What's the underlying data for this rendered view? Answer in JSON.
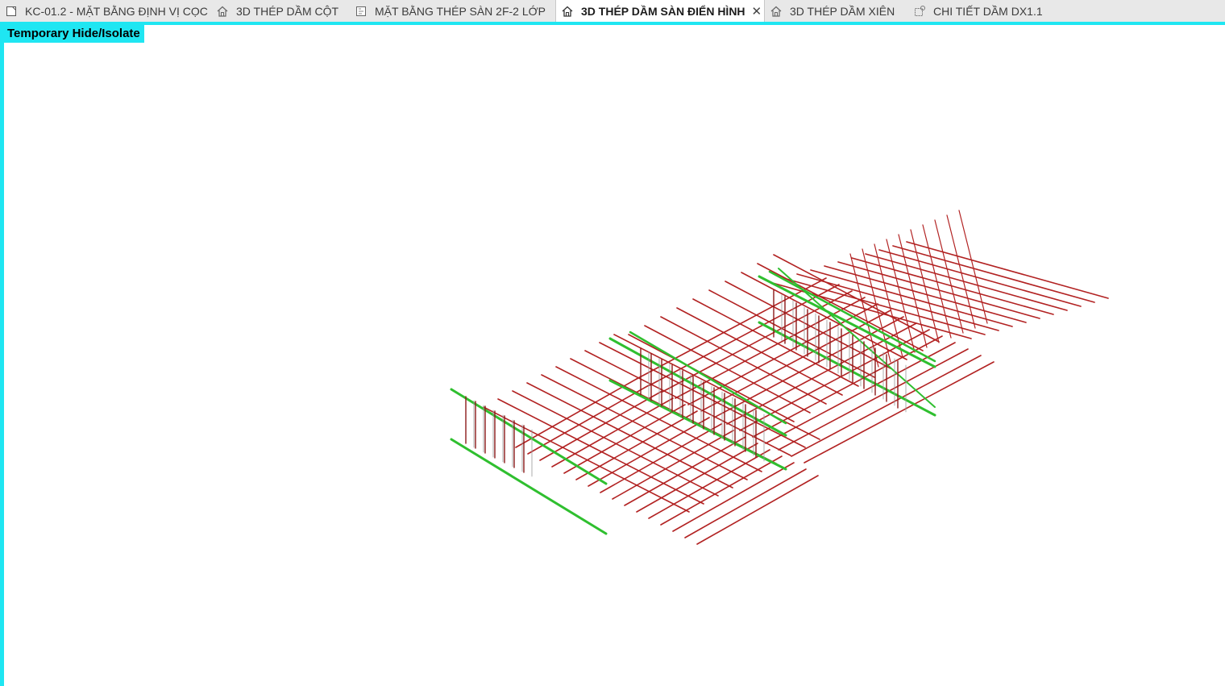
{
  "tabs": [
    {
      "label": "KC-01.2 - MẶT BẰNG ĐỊNH VỊ CỌC",
      "icon": "sheet-icon",
      "active": false
    },
    {
      "label": "3D THÉP DẦM CỘT",
      "icon": "3d-house-icon",
      "active": false
    },
    {
      "label": "MẶT BẰNG THÉP SÀN 2F-2 LỚP",
      "icon": "floor-plan-icon",
      "active": false
    },
    {
      "label": "3D THÉP DẦM SÀN ĐIỂN HÌNH",
      "icon": "3d-house-icon",
      "active": true
    },
    {
      "label": "3D THÉP DẦM XIÊN",
      "icon": "3d-house-icon",
      "active": false
    },
    {
      "label": "CHI TIẾT DẦM DX1.1",
      "icon": "detail-view-icon",
      "active": false
    }
  ],
  "close_glyph": "✕",
  "viewport": {
    "mode_banner": "Temporary Hide/Isolate",
    "border_color": "#1fe6f2",
    "rebar_colors": {
      "slab_bars": "#b22222",
      "beam_bars": "#2fbf2f",
      "stirrups": "#8b1a1a"
    }
  }
}
